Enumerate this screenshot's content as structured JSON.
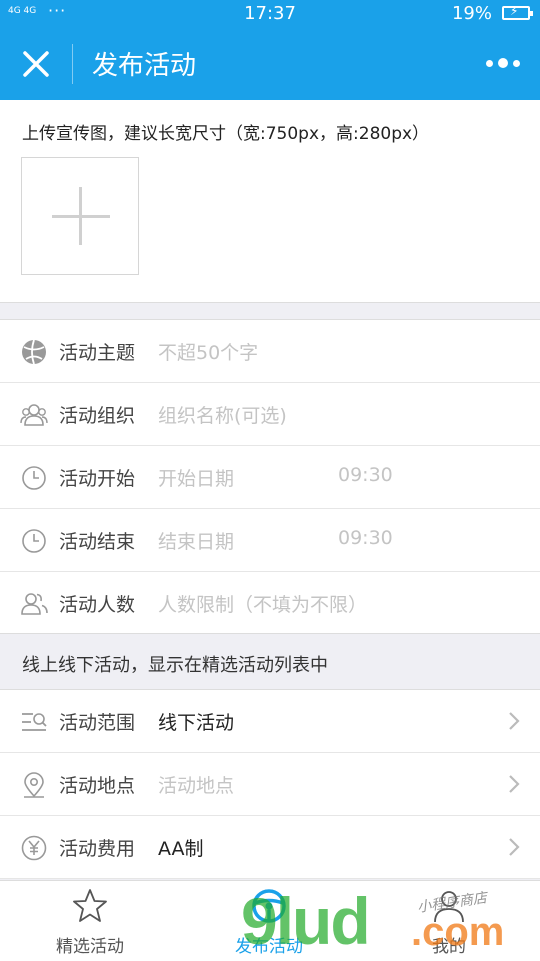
{
  "status_bar": {
    "network": "4G 4G",
    "dots": "···",
    "time": "17:37",
    "battery": "19%"
  },
  "nav": {
    "title": "发布活动",
    "close_icon": "close-icon",
    "more_icon": "more-dots-icon"
  },
  "upload": {
    "hint": "上传宣传图，建议长宽尺寸（宽:750px，高:280px）",
    "button_icon": "plus-icon"
  },
  "form": {
    "theme": {
      "label": "活动主题",
      "placeholder": "不超50个字",
      "icon": "ball-icon"
    },
    "org": {
      "label": "活动组织",
      "placeholder": "组织名称(可选)",
      "icon": "group-icon"
    },
    "start": {
      "label": "活动开始",
      "date_placeholder": "开始日期",
      "time": "09:30",
      "icon": "clock-icon"
    },
    "end": {
      "label": "活动结束",
      "date_placeholder": "结束日期",
      "time": "09:30",
      "icon": "clock-icon"
    },
    "people": {
      "label": "活动人数",
      "placeholder": "人数限制（不填为不限）",
      "icon": "people-icon"
    }
  },
  "section_hint": "线上线下活动，显示在精选活动列表中",
  "options": {
    "scope": {
      "label": "活动范围",
      "value": "线下活动",
      "icon": "list-search-icon"
    },
    "location": {
      "label": "活动地点",
      "placeholder": "活动地点",
      "icon": "location-pin-icon"
    },
    "fee": {
      "label": "活动费用",
      "value": "AA制",
      "icon": "yen-icon"
    }
  },
  "tabs": [
    {
      "label": "精选活动",
      "icon": "star-icon",
      "active": false
    },
    {
      "label": "发布活动",
      "icon": "steering-wheel-icon",
      "active": true
    },
    {
      "label": "我的",
      "icon": "user-icon",
      "active": false
    }
  ],
  "watermark": {
    "big": "9lud",
    "com": ".com",
    "small": "小程序商店"
  },
  "colors": {
    "primary": "#1aa1e9",
    "placeholder": "#c4c4c4",
    "background": "#efeff4"
  }
}
